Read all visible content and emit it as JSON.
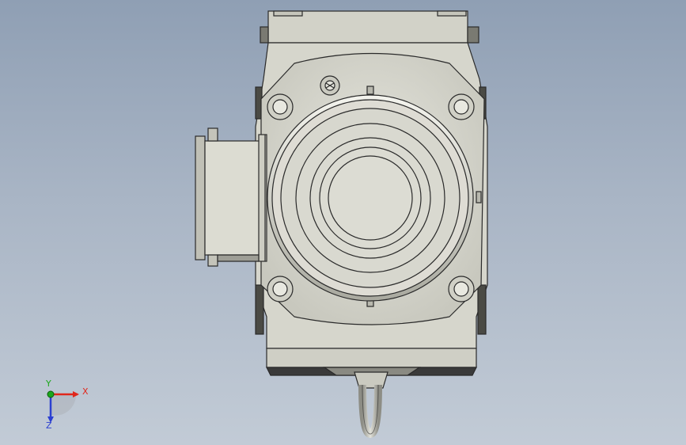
{
  "viewport": {
    "background_top": "#8f9fb4",
    "background_bottom": "#c2cbd6"
  },
  "model": {
    "body_color": "#d6d6cc",
    "shadow_color": "#9a9a90",
    "edge_color": "#2a2a2a",
    "dark_color": "#3a3a3a"
  },
  "triad": {
    "x_label": "X",
    "y_label": "Y",
    "z_label": "Z",
    "x_color": "#e0261b",
    "y_color": "#1ca81c",
    "z_color": "#2b3fd1"
  }
}
